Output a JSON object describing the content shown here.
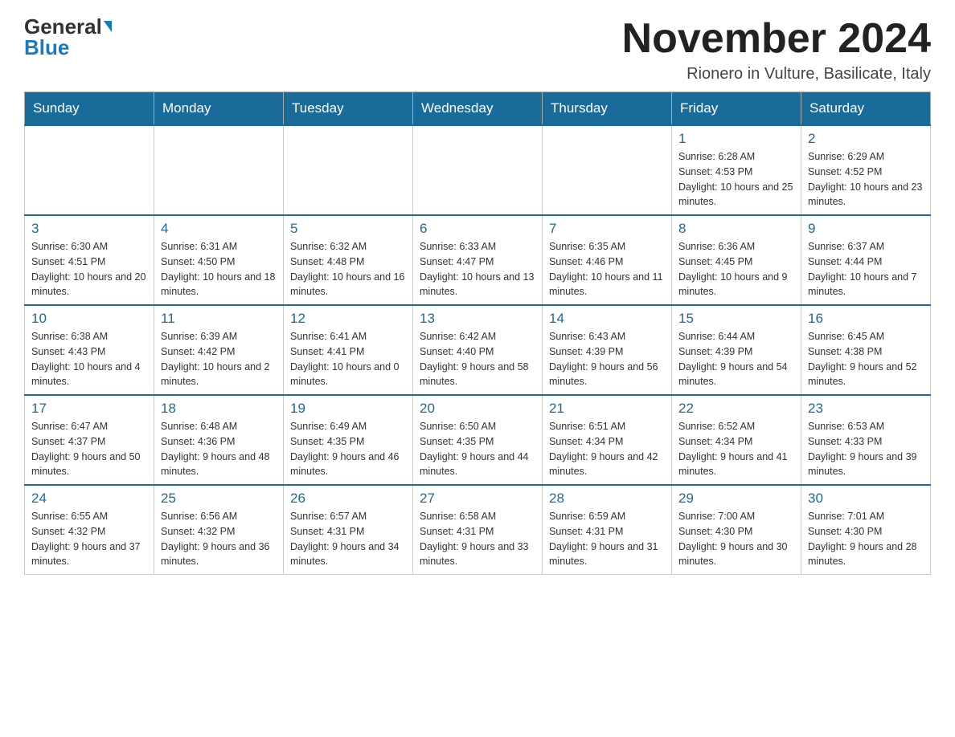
{
  "header": {
    "logo_general": "General",
    "logo_blue": "Blue",
    "month_title": "November 2024",
    "location": "Rionero in Vulture, Basilicate, Italy"
  },
  "days_of_week": [
    "Sunday",
    "Monday",
    "Tuesday",
    "Wednesday",
    "Thursday",
    "Friday",
    "Saturday"
  ],
  "weeks": [
    [
      {
        "day": "",
        "info": ""
      },
      {
        "day": "",
        "info": ""
      },
      {
        "day": "",
        "info": ""
      },
      {
        "day": "",
        "info": ""
      },
      {
        "day": "",
        "info": ""
      },
      {
        "day": "1",
        "info": "Sunrise: 6:28 AM\nSunset: 4:53 PM\nDaylight: 10 hours and 25 minutes."
      },
      {
        "day": "2",
        "info": "Sunrise: 6:29 AM\nSunset: 4:52 PM\nDaylight: 10 hours and 23 minutes."
      }
    ],
    [
      {
        "day": "3",
        "info": "Sunrise: 6:30 AM\nSunset: 4:51 PM\nDaylight: 10 hours and 20 minutes."
      },
      {
        "day": "4",
        "info": "Sunrise: 6:31 AM\nSunset: 4:50 PM\nDaylight: 10 hours and 18 minutes."
      },
      {
        "day": "5",
        "info": "Sunrise: 6:32 AM\nSunset: 4:48 PM\nDaylight: 10 hours and 16 minutes."
      },
      {
        "day": "6",
        "info": "Sunrise: 6:33 AM\nSunset: 4:47 PM\nDaylight: 10 hours and 13 minutes."
      },
      {
        "day": "7",
        "info": "Sunrise: 6:35 AM\nSunset: 4:46 PM\nDaylight: 10 hours and 11 minutes."
      },
      {
        "day": "8",
        "info": "Sunrise: 6:36 AM\nSunset: 4:45 PM\nDaylight: 10 hours and 9 minutes."
      },
      {
        "day": "9",
        "info": "Sunrise: 6:37 AM\nSunset: 4:44 PM\nDaylight: 10 hours and 7 minutes."
      }
    ],
    [
      {
        "day": "10",
        "info": "Sunrise: 6:38 AM\nSunset: 4:43 PM\nDaylight: 10 hours and 4 minutes."
      },
      {
        "day": "11",
        "info": "Sunrise: 6:39 AM\nSunset: 4:42 PM\nDaylight: 10 hours and 2 minutes."
      },
      {
        "day": "12",
        "info": "Sunrise: 6:41 AM\nSunset: 4:41 PM\nDaylight: 10 hours and 0 minutes."
      },
      {
        "day": "13",
        "info": "Sunrise: 6:42 AM\nSunset: 4:40 PM\nDaylight: 9 hours and 58 minutes."
      },
      {
        "day": "14",
        "info": "Sunrise: 6:43 AM\nSunset: 4:39 PM\nDaylight: 9 hours and 56 minutes."
      },
      {
        "day": "15",
        "info": "Sunrise: 6:44 AM\nSunset: 4:39 PM\nDaylight: 9 hours and 54 minutes."
      },
      {
        "day": "16",
        "info": "Sunrise: 6:45 AM\nSunset: 4:38 PM\nDaylight: 9 hours and 52 minutes."
      }
    ],
    [
      {
        "day": "17",
        "info": "Sunrise: 6:47 AM\nSunset: 4:37 PM\nDaylight: 9 hours and 50 minutes."
      },
      {
        "day": "18",
        "info": "Sunrise: 6:48 AM\nSunset: 4:36 PM\nDaylight: 9 hours and 48 minutes."
      },
      {
        "day": "19",
        "info": "Sunrise: 6:49 AM\nSunset: 4:35 PM\nDaylight: 9 hours and 46 minutes."
      },
      {
        "day": "20",
        "info": "Sunrise: 6:50 AM\nSunset: 4:35 PM\nDaylight: 9 hours and 44 minutes."
      },
      {
        "day": "21",
        "info": "Sunrise: 6:51 AM\nSunset: 4:34 PM\nDaylight: 9 hours and 42 minutes."
      },
      {
        "day": "22",
        "info": "Sunrise: 6:52 AM\nSunset: 4:34 PM\nDaylight: 9 hours and 41 minutes."
      },
      {
        "day": "23",
        "info": "Sunrise: 6:53 AM\nSunset: 4:33 PM\nDaylight: 9 hours and 39 minutes."
      }
    ],
    [
      {
        "day": "24",
        "info": "Sunrise: 6:55 AM\nSunset: 4:32 PM\nDaylight: 9 hours and 37 minutes."
      },
      {
        "day": "25",
        "info": "Sunrise: 6:56 AM\nSunset: 4:32 PM\nDaylight: 9 hours and 36 minutes."
      },
      {
        "day": "26",
        "info": "Sunrise: 6:57 AM\nSunset: 4:31 PM\nDaylight: 9 hours and 34 minutes."
      },
      {
        "day": "27",
        "info": "Sunrise: 6:58 AM\nSunset: 4:31 PM\nDaylight: 9 hours and 33 minutes."
      },
      {
        "day": "28",
        "info": "Sunrise: 6:59 AM\nSunset: 4:31 PM\nDaylight: 9 hours and 31 minutes."
      },
      {
        "day": "29",
        "info": "Sunrise: 7:00 AM\nSunset: 4:30 PM\nDaylight: 9 hours and 30 minutes."
      },
      {
        "day": "30",
        "info": "Sunrise: 7:01 AM\nSunset: 4:30 PM\nDaylight: 9 hours and 28 minutes."
      }
    ]
  ]
}
